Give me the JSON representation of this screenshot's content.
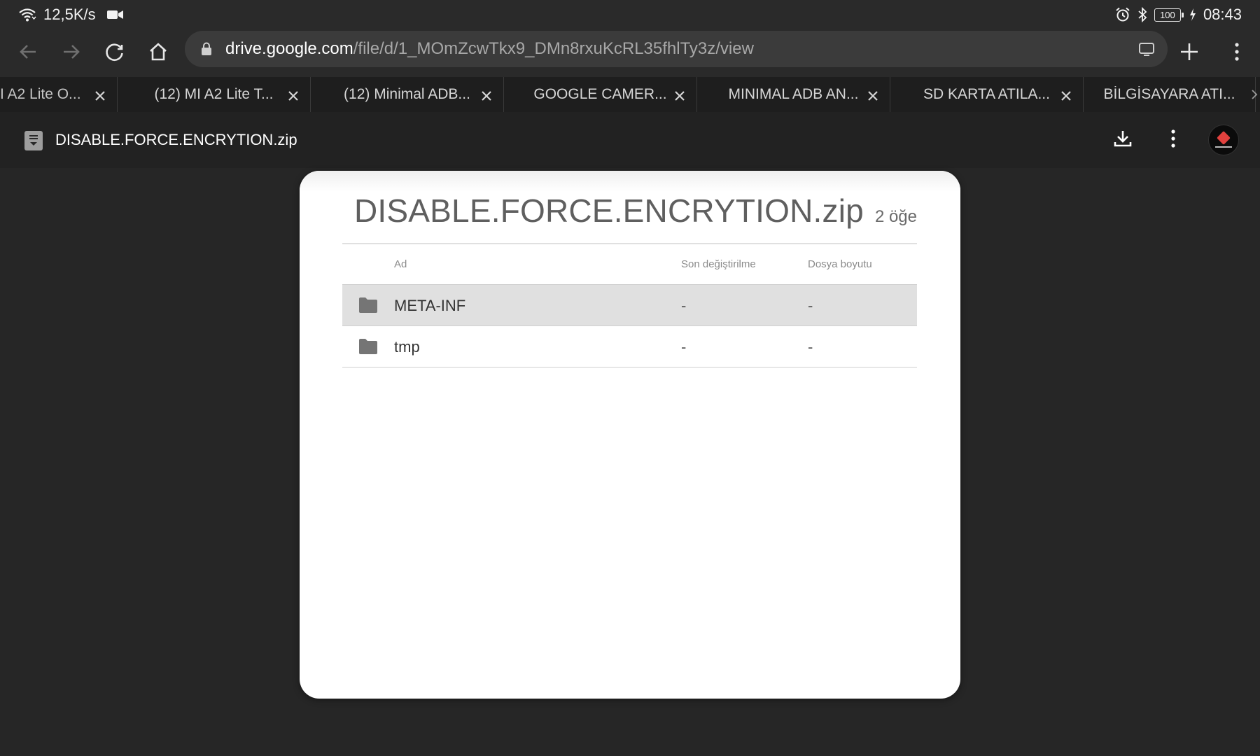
{
  "status_bar": {
    "speed": "12,5K/s",
    "battery": "100",
    "time": "08:43"
  },
  "browser": {
    "url_host": "drive.google.com",
    "url_path": "/file/d/1_MOmZcwTkx9_DMn8rxuKcRL35fhlTy3z/view",
    "tabs": [
      {
        "title": "I A2 Lite O..."
      },
      {
        "title": "(12) MI A2 Lite T..."
      },
      {
        "title": "(12) Minimal ADB..."
      },
      {
        "title": "GOOGLE CAMER..."
      },
      {
        "title": "MINIMAL ADB AN..."
      },
      {
        "title": "SD KARTA ATILA..."
      },
      {
        "title": "BİLGİSAYARA ATI..."
      }
    ]
  },
  "viewer": {
    "file_title": "DISABLE.FORCE.ENCRYTION.zip"
  },
  "zip": {
    "name": "DISABLE.FORCE.ENCRYTION.zip",
    "item_count": "2 öğe",
    "columns": {
      "name": "Ad",
      "modified": "Son değiştirilme",
      "size": "Dosya boyutu"
    },
    "rows": [
      {
        "name": "META-INF",
        "modified": "-",
        "size": "-",
        "selected": true
      },
      {
        "name": "tmp",
        "modified": "-",
        "size": "-",
        "selected": false
      }
    ]
  },
  "icons": [
    "wifi-icon",
    "video-camera-icon",
    "alarm-icon",
    "bluetooth-icon",
    "battery-icon",
    "charging-icon",
    "back-arrow-icon",
    "forward-arrow-icon",
    "reload-icon",
    "home-icon",
    "lock-icon",
    "tab-switcher-icon",
    "new-tab-icon",
    "menu-icon",
    "tab-close-icon",
    "document-icon",
    "download-icon",
    "more-vert-icon",
    "folder-icon"
  ]
}
